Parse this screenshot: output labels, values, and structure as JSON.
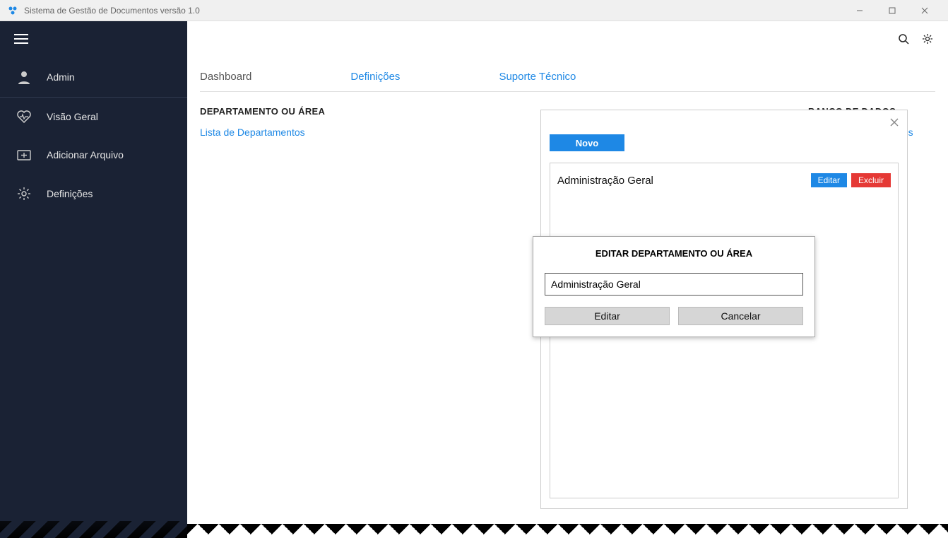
{
  "window": {
    "title": "Sistema de Gestão de Documentos versão 1.0"
  },
  "sidebar": {
    "user_label": "Admin",
    "items": [
      {
        "label": "Visão Geral"
      },
      {
        "label": "Adicionar Arquivo"
      },
      {
        "label": "Definições"
      }
    ]
  },
  "tabs": {
    "dashboard": "Dashboard",
    "definicoes": "Definições",
    "suporte": "Suporte Técnico"
  },
  "dept": {
    "heading": "DEPARTAMENTO OU ÁREA",
    "link": "Lista de Departamentos"
  },
  "db": {
    "heading": "BANCO DE DADOS",
    "link": "Alterar Banco de Dados"
  },
  "list_panel": {
    "novo": "Novo",
    "rows": [
      {
        "name": "Administração Geral",
        "edit": "Editar",
        "del": "Excluir"
      }
    ]
  },
  "edit_dialog": {
    "title": "EDITAR DEPARTAMENTO OU ÁREA",
    "value": "Administração Geral",
    "edit_btn": "Editar",
    "cancel_btn": "Cancelar"
  }
}
